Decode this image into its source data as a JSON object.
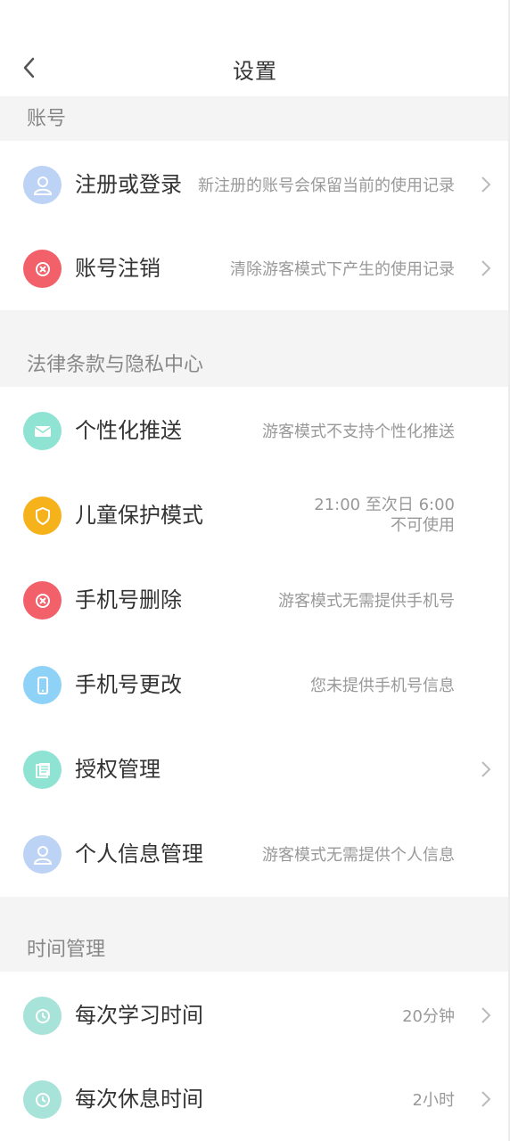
{
  "header": {
    "title": "设置"
  },
  "sections": [
    {
      "title": "账号",
      "items": [
        {
          "label": "注册或登录",
          "value": "新注册的账号会保留当前的使用记录",
          "chevron": true
        },
        {
          "label": "账号注销",
          "value": "清除游客模式下产生的使用记录",
          "chevron": true
        }
      ]
    },
    {
      "title": "法律条款与隐私中心",
      "items": [
        {
          "label": "个性化推送",
          "value": "游客模式不支持个性化推送",
          "chevron": false
        },
        {
          "label": "儿童保护模式",
          "value_line1": "21:00 至次日 6:00",
          "value_line2": "不可使用",
          "chevron": false
        },
        {
          "label": "手机号删除",
          "value": "游客模式无需提供手机号",
          "chevron": false
        },
        {
          "label": "手机号更改",
          "value": "您未提供手机号信息",
          "chevron": false
        },
        {
          "label": "授权管理",
          "value": "",
          "chevron": true
        },
        {
          "label": "个人信息管理",
          "value": "游客模式无需提供个人信息",
          "chevron": false
        }
      ]
    },
    {
      "title": "时间管理",
      "items": [
        {
          "label": "每次学习时间",
          "value": "20分钟",
          "chevron": true
        },
        {
          "label": "每次休息时间",
          "value": "2小时",
          "chevron": true
        }
      ]
    }
  ],
  "colors": {
    "user_icon": "#bcd3f5",
    "delete_icon": "#f2606a",
    "mail_icon": "#8fe3d3",
    "shield_icon": "#f6b21a",
    "phone_icon": "#8fd2f7",
    "clock_icon": "#a8e3da"
  }
}
